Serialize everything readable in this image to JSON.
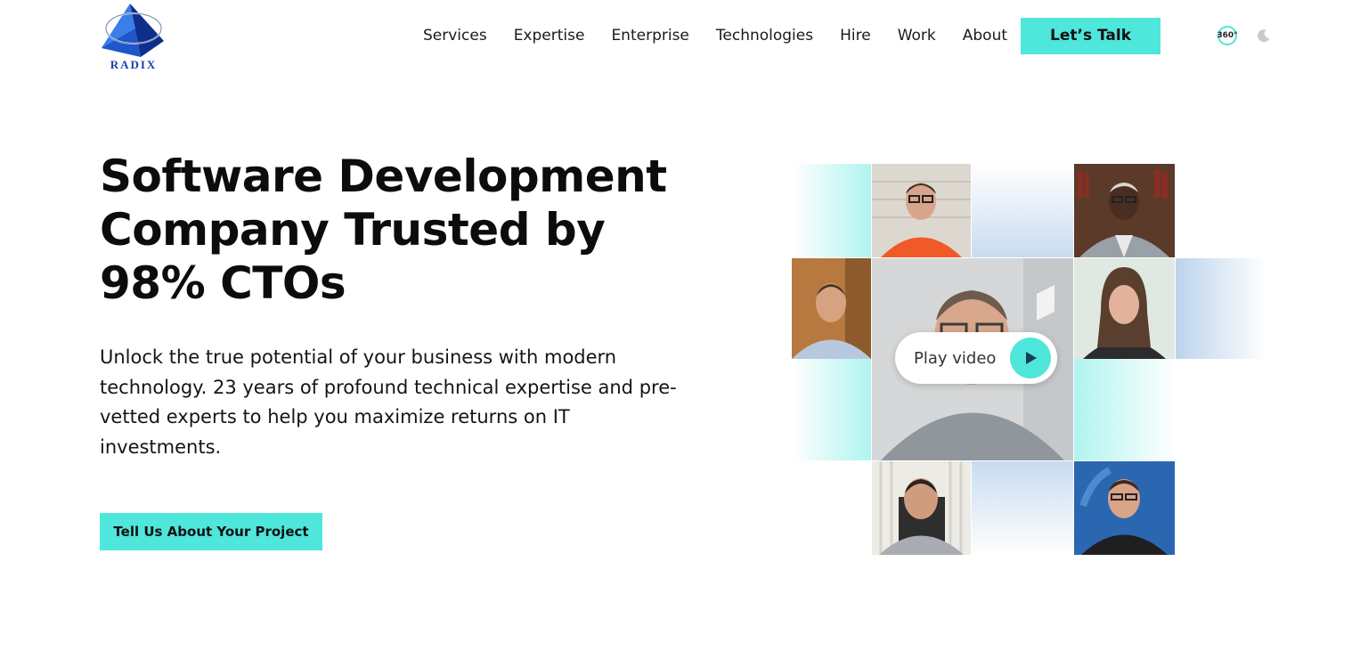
{
  "header": {
    "logo_text": "RADIX",
    "nav": [
      "Services",
      "Expertise",
      "Enterprise",
      "Technologies",
      "Hire",
      "Work",
      "About"
    ],
    "cta_label": "Let’s Talk",
    "view_360_label": "360°",
    "theme_icon": "moon-icon"
  },
  "hero": {
    "title": "Software Development Company Trusted by 98% CTOs",
    "description": "Unlock the true potential of your business with modern technology. 23 years of profound technical expertise and pre-vetted experts to help you maximize returns on IT investments.",
    "cta_label": "Tell Us About Your Project"
  },
  "video": {
    "play_label": "Play video",
    "play_icon": "play-icon"
  },
  "colors": {
    "accent": "#4fe6dc",
    "logo_blue": "#1a3ea8"
  }
}
